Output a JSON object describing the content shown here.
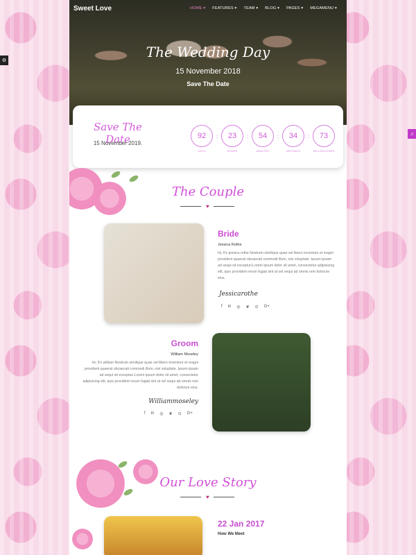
{
  "nav": {
    "brand": "Sweet Love",
    "items": [
      "HOME ▾",
      "FEATURES ▾",
      "TEAM ▾",
      "BLOG ▾",
      "PAGES ▾",
      "MEGAMENU ▾"
    ]
  },
  "hero": {
    "title": "The Wedding Day",
    "date": "15 November 2018",
    "save": "Save The Date"
  },
  "countdown": {
    "title": "Save The Date",
    "date": "15 November 2019.",
    "values": [
      "92",
      "23",
      "54",
      "34",
      "73"
    ],
    "labels": [
      "DAYS",
      "HOURS",
      "MINUTES",
      "SECONDS",
      "MILLISECONDS"
    ]
  },
  "couple": {
    "title": "The Couple",
    "bride": {
      "role": "Bride",
      "name": "Jessica Rothe",
      "bio": "Hi, It's jessica rothe Nostrum similique quae vel libero inventore et magni provident quaerat obcaecati commodi illum, nisi voluptate. Ipsum ipsam ad sequi sit excepturi.Lorem ipsum dolor sit amet, consectetur adipisicing elit, quis provident rerum fugiat sint at vel sequi ab omnis rem dolorum eius.",
      "signature": "Jessicarothe"
    },
    "groom": {
      "role": "Groom",
      "name": "William Moseley",
      "bio": "Hi, It's william Nostrum similique quae vel libero inventore et magni provident quaerat obcaecati commodi illum, nisi voluptate. Ipsum ipsam ad sequi sit excepturi.Lorem ipsum dolor sit amet, consectetur adipisicing elit, quis provident rerum fugiat sint at vel sequi ab omnis rem dolorum eius.",
      "signature": "Williammoseley"
    }
  },
  "social_icons": [
    "f",
    "in",
    "◎",
    "❦",
    "⊙",
    "G+"
  ],
  "story": {
    "title": "Our Love Story",
    "date": "22 Jan 2017",
    "subtitle": "How We Meet"
  },
  "colors": {
    "accent": "#d14fd7",
    "sidetab_settings": "#222222",
    "sidetab_music": "#c13ac9"
  }
}
